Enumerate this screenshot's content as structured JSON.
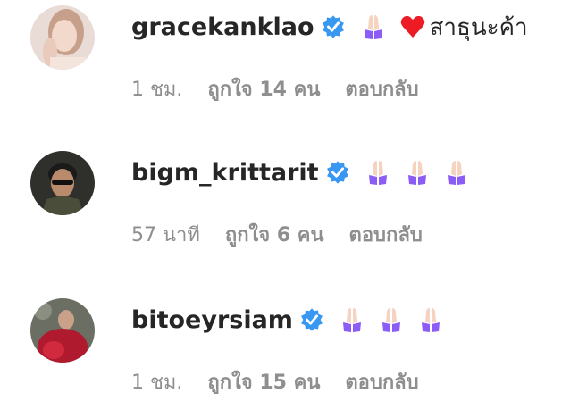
{
  "comments": [
    {
      "username": "gracekanklao",
      "verified": true,
      "reactions": [
        "folded-hands",
        "red-heart"
      ],
      "text": "สาธุนะค้า",
      "time": "1 ชม.",
      "likes": "ถูกใจ 14 คน",
      "reply": "ตอบกลับ"
    },
    {
      "username": "bigm_krittarit",
      "verified": true,
      "reactions": [
        "folded-hands",
        "folded-hands",
        "folded-hands"
      ],
      "text": "",
      "time": "57 นาที",
      "likes": "ถูกใจ 6 คน",
      "reply": "ตอบกลับ"
    },
    {
      "username": "bitoeyrsiam",
      "verified": true,
      "reactions": [
        "folded-hands",
        "folded-hands",
        "folded-hands"
      ],
      "text": "",
      "time": "1 ชม.",
      "likes": "ถูกใจ 15 คน",
      "reply": "ตอบกลับ"
    }
  ],
  "colors": {
    "username": "#262626",
    "meta": "#8e8e8e",
    "verified": "#3897f0",
    "heart": "#ed1c24",
    "sleeve": "#8b5cf6",
    "hands": "#f5d3c0"
  }
}
